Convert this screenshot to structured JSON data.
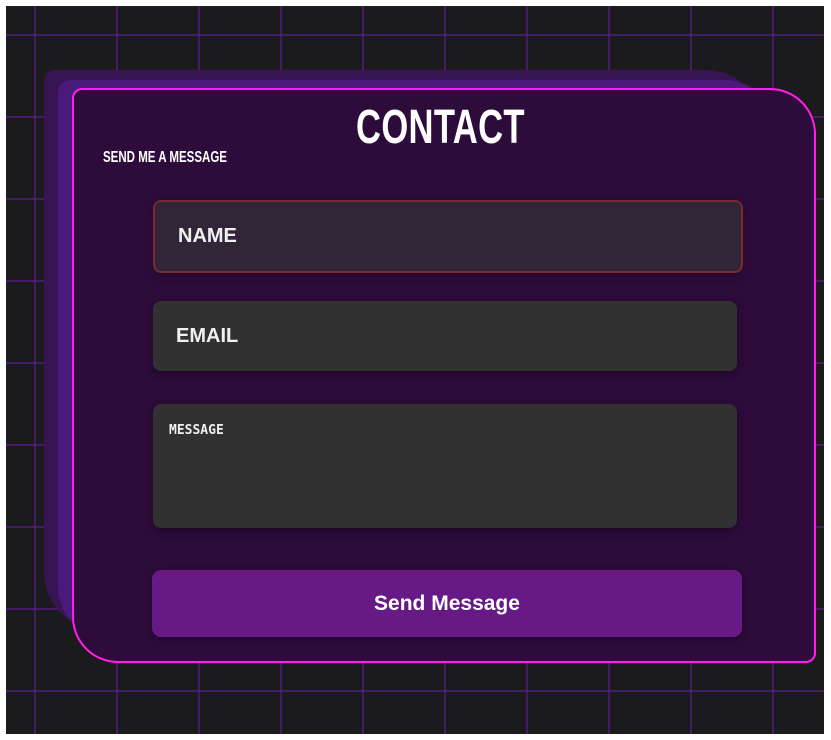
{
  "contact_form": {
    "title": "CONTACT",
    "subtitle": "SEND ME A MESSAGE",
    "name_placeholder": "NAME",
    "email_placeholder": "EMAIL",
    "message_placeholder": "MESSAGE",
    "send_label": "Send Message"
  },
  "colors": {
    "page_background": "#1b1b1d",
    "grid_line": "#6a1aa0",
    "card_background": "#2d0b3a",
    "card_border": "#ff1fe8",
    "field_background": "#313131",
    "focused_field_border": "#7a2a35",
    "button_background": "#671a86",
    "text": "#ffffff"
  }
}
